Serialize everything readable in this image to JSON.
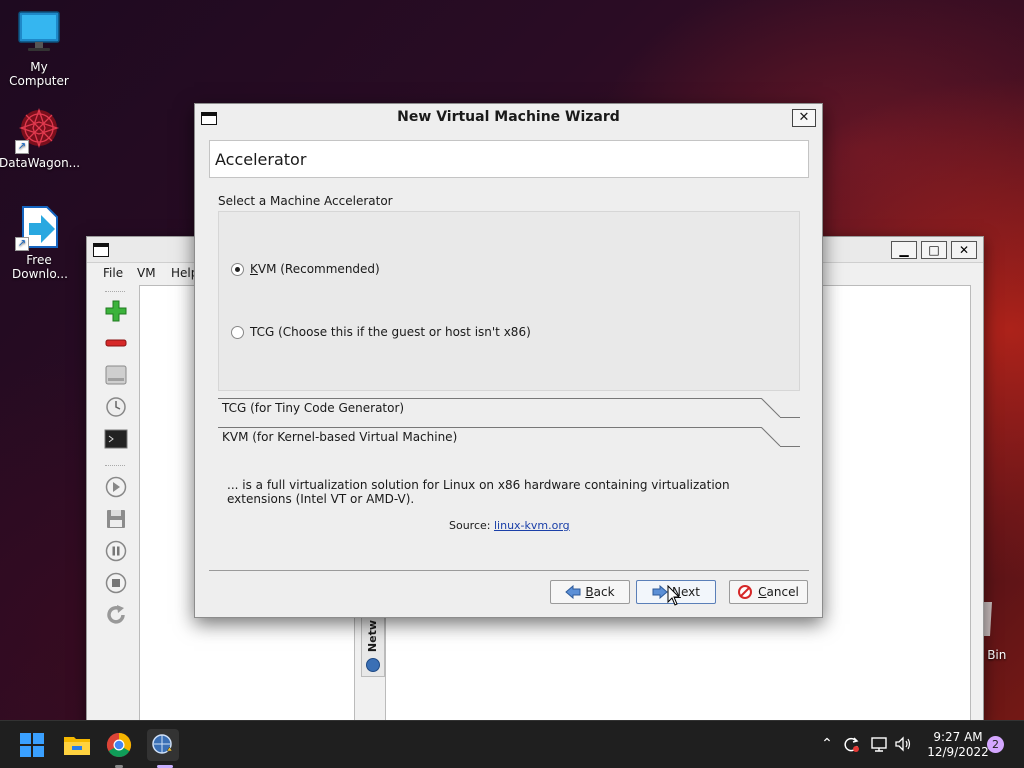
{
  "desktop": {
    "icons": [
      {
        "label": "My Computer"
      },
      {
        "label": "DataWagon..."
      },
      {
        "label": "Free Downlo..."
      }
    ],
    "recycle_bin_fragment": "e Bin"
  },
  "back_window": {
    "menu": [
      "File",
      "VM",
      "Help"
    ],
    "side_tab_label": "Netw"
  },
  "dialog": {
    "title": "New Virtual Machine Wizard",
    "close_symbol": "✕",
    "page_title": "Accelerator",
    "section_label": "Select a Machine Accelerator",
    "options": [
      {
        "label_first": "K",
        "label_rest": "VM (Recommended)",
        "checked": true
      },
      {
        "label_first": "",
        "label_rest": "TCG (Choose this if the guest or host isn't x86)",
        "checked": false
      }
    ],
    "collapsibles": [
      {
        "label": "TCG (for Tiny Code Generator)"
      },
      {
        "label": "KVM (for Kernel-based Virtual Machine)"
      }
    ],
    "description": "... is a full virtualization solution for Linux on x86 hardware containing virtualization extensions (Intel VT or AMD-V).",
    "source_prefix": "Source: ",
    "source_link": "linux-kvm.org",
    "buttons": {
      "back_first": "B",
      "back_rest": "ack",
      "next_first": "N",
      "next_rest": "ext",
      "cancel_first": "C",
      "cancel_rest": "ancel"
    }
  },
  "taskbar": {
    "time": "9:27 AM",
    "date": "12/9/2022",
    "notification_count": "2",
    "apps": [
      "start-icon",
      "file-explorer-icon",
      "chrome-icon",
      "virt-manager-icon"
    ]
  },
  "colors": {
    "link": "#1a3fa8",
    "badge": "#d4a7ff",
    "add_icon": "#3bb33b",
    "remove_icon": "#d62828"
  }
}
